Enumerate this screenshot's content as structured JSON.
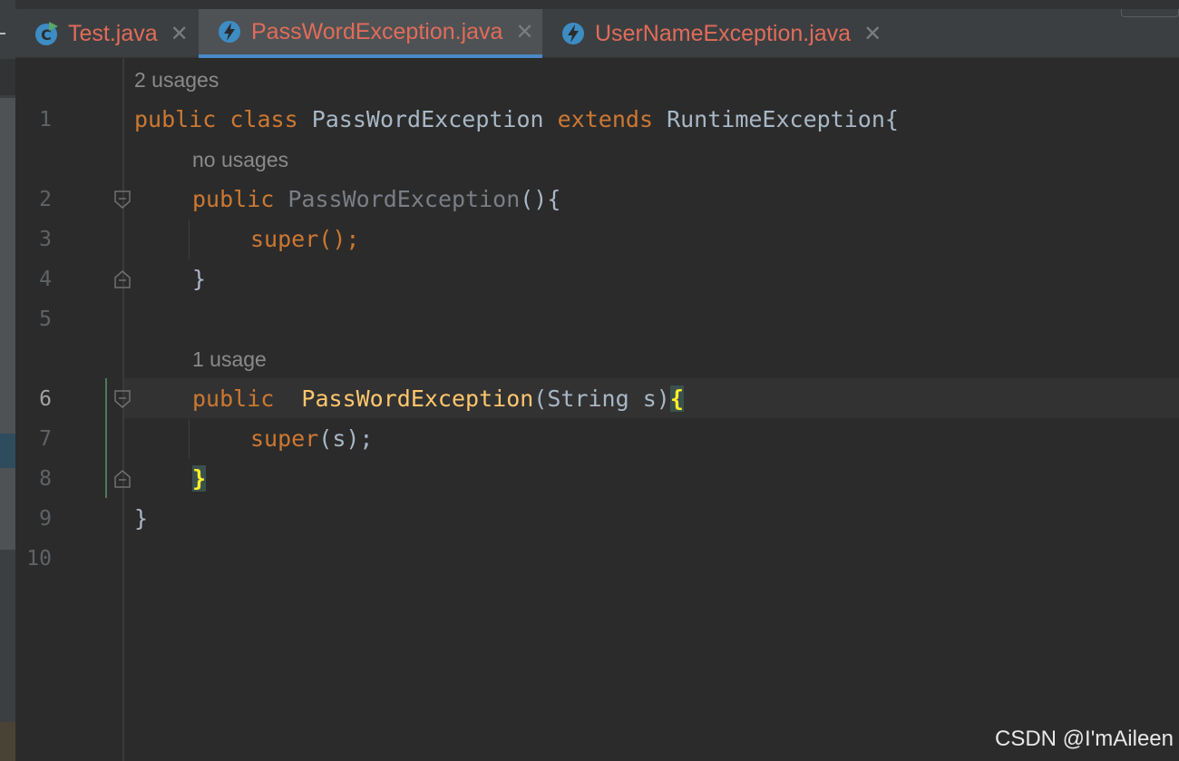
{
  "tabs": [
    {
      "label": "Test.java",
      "icon": "class-run-icon",
      "active": false
    },
    {
      "label": "PassWordException.java",
      "icon": "exception-class-icon",
      "active": true
    },
    {
      "label": "UserNameException.java",
      "icon": "exception-class-icon",
      "active": false
    }
  ],
  "tab_close_glyph": "✕",
  "hints": {
    "line1": "2 usages",
    "line2": "no usages",
    "line6": "1 usage"
  },
  "line_numbers": [
    "1",
    "2",
    "3",
    "4",
    "5",
    "6",
    "7",
    "8",
    "9",
    "10"
  ],
  "current_line": 6,
  "code": {
    "l1_public": "public",
    "l1_class": "class",
    "l1_name": "PassWordException",
    "l1_extends": "extends",
    "l1_rest": "RuntimeException{",
    "l2_public": "public",
    "l2_name": "PassWordException",
    "l2_rest": "(){",
    "l3_super": "super",
    "l3_rest": "();",
    "l4": "}",
    "l6_public": "public",
    "l6_name": "PassWordException",
    "l6_rest": "(String s)",
    "l6_brace": "{",
    "l7_super": "super",
    "l7_rest": "(s);",
    "l8": "}",
    "l9": "}"
  },
  "watermark": "CSDN @I'mAileen",
  "colors": {
    "background": "#2b2b2b",
    "keyword": "#cc7832",
    "function": "#ffc66d",
    "text": "#a9b7c6",
    "tab_label": "#e06c5a",
    "active_tab_underline": "#4a88c7"
  }
}
